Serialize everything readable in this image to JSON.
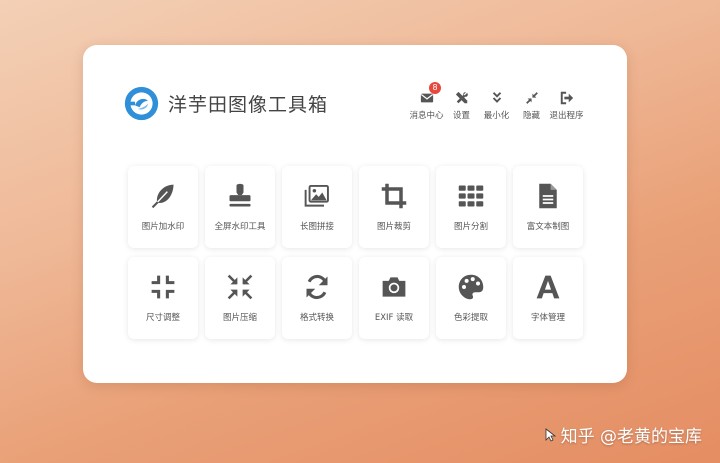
{
  "app": {
    "title": "洋芋田图像工具箱",
    "accent": "#2f8fd8",
    "icon_color": "#555555"
  },
  "toolbar": [
    {
      "icon": "envelope-icon",
      "label": "消息中心",
      "badge": "8"
    },
    {
      "icon": "wrench-screwdriver-icon",
      "label": "设置"
    },
    {
      "icon": "double-chevron-down-icon",
      "label": "最小化"
    },
    {
      "icon": "compress-arrows-icon",
      "label": "隐藏"
    },
    {
      "icon": "sign-out-icon",
      "label": "退出程序"
    }
  ],
  "tools": [
    {
      "icon": "feather-icon",
      "label": "图片加水印"
    },
    {
      "icon": "stamp-icon",
      "label": "全屏水印工具"
    },
    {
      "icon": "images-icon",
      "label": "长图拼接"
    },
    {
      "icon": "crop-icon",
      "label": "图片裁剪"
    },
    {
      "icon": "grid-icon",
      "label": "图片分割"
    },
    {
      "icon": "document-icon",
      "label": "富文本制图"
    },
    {
      "icon": "compress-icon",
      "label": "尺寸调整"
    },
    {
      "icon": "shrink-arrows-icon",
      "label": "图片压缩"
    },
    {
      "icon": "sync-icon",
      "label": "格式转换"
    },
    {
      "icon": "camera-icon",
      "label": "EXIF 读取"
    },
    {
      "icon": "palette-icon",
      "label": "色彩提取"
    },
    {
      "icon": "font-icon",
      "label": "字体管理"
    }
  ],
  "watermark": {
    "text": "知乎 @老黄的宝库"
  }
}
